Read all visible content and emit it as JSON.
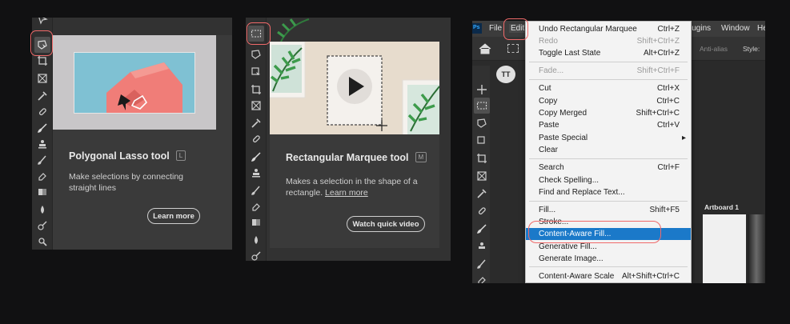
{
  "panel1": {
    "title": "Polygonal Lasso tool",
    "shortcut": "L",
    "description": "Make selections by connecting straight lines",
    "button_label": "Learn more"
  },
  "panel2": {
    "title": "Rectangular Marquee tool",
    "shortcut": "M",
    "description": "Makes a selection in the shape of a rectangle.",
    "description_link": "Learn more",
    "button_label": "Watch quick video"
  },
  "panel3": {
    "menubar": {
      "app_badge": "Ps",
      "file": "File",
      "edit": "Edit",
      "plugins": "lugins",
      "window": "Window",
      "help": "He"
    },
    "options": {
      "antialias": "Anti-alias",
      "style": "Style:"
    },
    "canvas_title": "Artboard 1",
    "menu_items": [
      {
        "label": "Undo Rectangular Marquee",
        "shortcut": "Ctrl+Z"
      },
      {
        "label": "Redo",
        "shortcut": "Shift+Ctrl+Z"
      },
      {
        "label": "Toggle Last State",
        "shortcut": "Alt+Ctrl+Z"
      },
      {
        "label": "Fade...",
        "shortcut": "Shift+Ctrl+F"
      },
      {
        "label": "Cut",
        "shortcut": "Ctrl+X"
      },
      {
        "label": "Copy",
        "shortcut": "Ctrl+C"
      },
      {
        "label": "Copy Merged",
        "shortcut": "Shift+Ctrl+C"
      },
      {
        "label": "Paste",
        "shortcut": "Ctrl+V"
      },
      {
        "label": "Paste Special",
        "shortcut": ""
      },
      {
        "label": "Clear",
        "shortcut": ""
      },
      {
        "label": "Search",
        "shortcut": "Ctrl+F"
      },
      {
        "label": "Check Spelling...",
        "shortcut": ""
      },
      {
        "label": "Find and Replace Text...",
        "shortcut": ""
      },
      {
        "label": "Fill...",
        "shortcut": "Shift+F5"
      },
      {
        "label": "Stroke...",
        "shortcut": ""
      },
      {
        "label": "Content-Aware Fill...",
        "shortcut": ""
      },
      {
        "label": "Generative Fill...",
        "shortcut": ""
      },
      {
        "label": "Generate Image...",
        "shortcut": ""
      },
      {
        "label": "Content-Aware Scale",
        "shortcut": "Alt+Shift+Ctrl+C"
      }
    ],
    "colors": {
      "highlight": "#1b79c9",
      "annotation": "#f06a6a"
    }
  }
}
